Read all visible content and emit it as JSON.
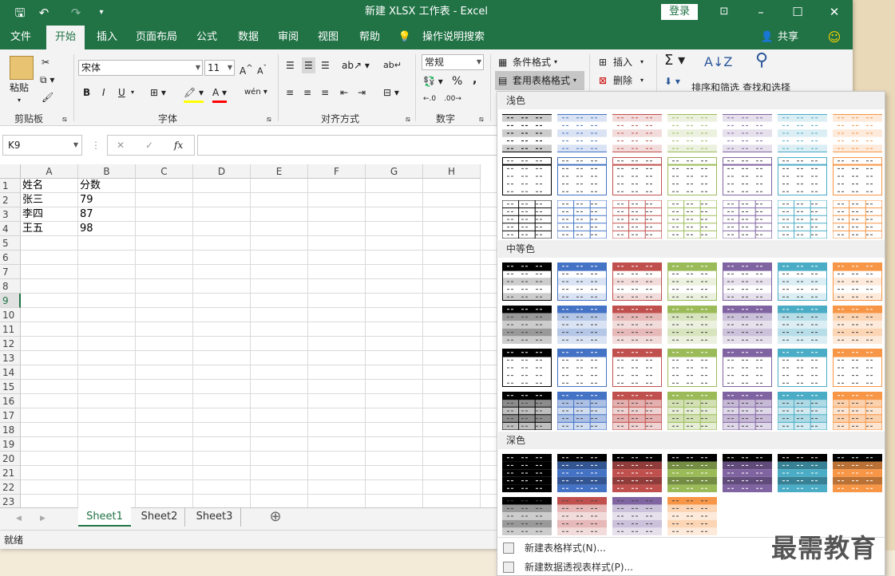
{
  "window": {
    "title": "新建 XLSX 工作表  -  Excel",
    "login": "登录",
    "share": "共享",
    "minimize": "–",
    "restore": "❐",
    "maximize": "☐",
    "close": "✕"
  },
  "tabs": [
    {
      "label": "文件"
    },
    {
      "label": "开始"
    },
    {
      "label": "插入"
    },
    {
      "label": "页面布局"
    },
    {
      "label": "公式"
    },
    {
      "label": "数据"
    },
    {
      "label": "审阅"
    },
    {
      "label": "视图"
    },
    {
      "label": "帮助"
    },
    {
      "label": "操作说明搜索"
    }
  ],
  "ribbon": {
    "clipboard": {
      "group": "剪贴板",
      "paste": "粘贴"
    },
    "font": {
      "group": "字体",
      "name": "宋体",
      "size": "11",
      "bold": "B",
      "italic": "I",
      "underline": "U"
    },
    "alignment": {
      "group": "对齐方式"
    },
    "number": {
      "group": "数字",
      "format": "常规",
      "percent": "%",
      "comma": ","
    },
    "styles": {
      "conditional": "条件格式",
      "table_format": "套用表格格式"
    },
    "cells": {
      "insert": "插入",
      "delete": "删除"
    },
    "editing": {
      "sort_filter": "排序和筛选",
      "find_select": "查找和选择"
    }
  },
  "formula_bar": {
    "name_box": "K9",
    "fx": "fx",
    "cancel": "✕",
    "enter": "✓",
    "value": ""
  },
  "grid": {
    "columns": [
      "A",
      "B",
      "C",
      "D",
      "E",
      "F",
      "G",
      "H"
    ],
    "rows": [
      "1",
      "2",
      "3",
      "4",
      "5",
      "6",
      "7",
      "8",
      "9",
      "10",
      "11",
      "12",
      "13",
      "14",
      "15",
      "16",
      "17",
      "18",
      "19",
      "20",
      "21",
      "22",
      "23"
    ],
    "selected_row": "9",
    "cells": [
      [
        "姓名",
        "分数"
      ],
      [
        "张三",
        "79"
      ],
      [
        "李四",
        "87"
      ],
      [
        "王五",
        "98"
      ]
    ]
  },
  "sheets": [
    {
      "label": "Sheet1"
    },
    {
      "label": "Sheet2"
    },
    {
      "label": "Sheet3"
    }
  ],
  "add_sheet": "⊕",
  "status": "就绪",
  "gallery": {
    "sections": [
      {
        "label": "浅色"
      },
      {
        "label": "中等色"
      },
      {
        "label": "深色"
      }
    ],
    "menu": [
      "新建表格样式(N)...",
      "新建数据透视表样式(P)..."
    ],
    "colors": {
      "black": "#000000",
      "blue": "#4472c4",
      "red": "#c0504d",
      "green": "#9bbb59",
      "purple": "#8064a2",
      "aqua": "#4bacc6",
      "orange": "#f79646"
    }
  },
  "watermark": "最需教育"
}
